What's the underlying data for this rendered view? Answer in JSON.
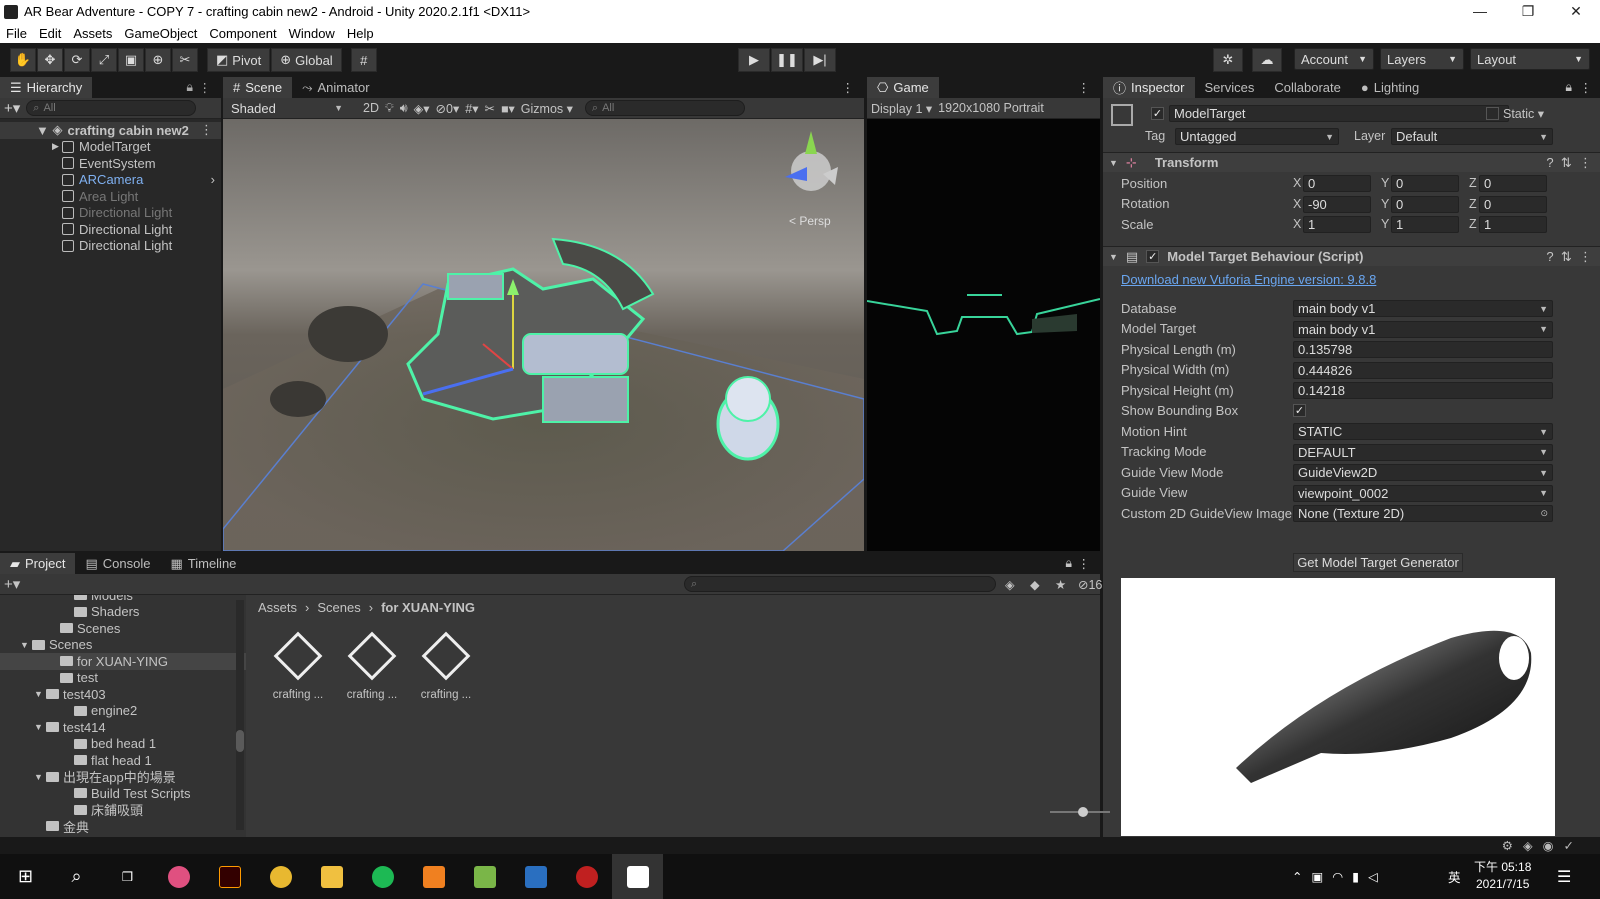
{
  "window": {
    "title": "AR Bear Adventure - COPY 7 - crafting cabin new2 - Android - Unity 2020.2.1f1 <DX11>",
    "min": "—",
    "max": "❐",
    "close": "✕"
  },
  "menu": [
    "File",
    "Edit",
    "Assets",
    "GameObject",
    "Component",
    "Window",
    "Help"
  ],
  "toolbar": {
    "pivot": "Pivot",
    "global": "Global",
    "account": "Account",
    "layers": "Layers",
    "layout": "Layout"
  },
  "hierarchy": {
    "tab": "Hierarchy",
    "search": "All",
    "scene": "crafting cabin new2",
    "items": [
      {
        "label": "ModelTarget",
        "state": "normal",
        "foldout": true
      },
      {
        "label": "EventSystem",
        "state": "normal",
        "foldout": false
      },
      {
        "label": "ARCamera",
        "state": "blue",
        "foldout": false
      },
      {
        "label": "Area Light",
        "state": "dim",
        "foldout": false
      },
      {
        "label": "Directional Light",
        "state": "dim",
        "foldout": false
      },
      {
        "label": "Directional Light",
        "state": "normal",
        "foldout": false
      },
      {
        "label": "Directional Light",
        "state": "normal",
        "foldout": false
      }
    ]
  },
  "scene": {
    "tab": "Scene",
    "tab2": "Animator",
    "shading": "Shaded",
    "mode2d": "2D",
    "hidden_count": "0",
    "gizmos": "Gizmos",
    "search": "All",
    "persp": "< Persp"
  },
  "game": {
    "tab": "Game",
    "display": "Display 1",
    "resolution": "1920x1080 Portrait"
  },
  "inspector": {
    "tabs": [
      "Inspector",
      "Services",
      "Collaborate",
      "Lighting"
    ],
    "object": "ModelTarget",
    "static": "Static",
    "tag_label": "Tag",
    "tag": "Untagged",
    "layer_label": "Layer",
    "layer": "Default",
    "transform": {
      "title": "Transform",
      "rows": [
        {
          "label": "Position",
          "x": "0",
          "y": "0",
          "z": "0"
        },
        {
          "label": "Rotation",
          "x": "-90",
          "y": "0",
          "z": "0"
        },
        {
          "label": "Scale",
          "x": "1",
          "y": "1",
          "z": "1"
        }
      ]
    },
    "script": {
      "title": "Model Target Behaviour (Script)",
      "link": "Download new Vuforia Engine version: 9.8.8",
      "props": [
        {
          "label": "Database",
          "value": "main body v1",
          "dropdown": true
        },
        {
          "label": "Model Target",
          "value": "main body v1",
          "dropdown": true
        },
        {
          "label": "Physical Length (m)",
          "value": "0.135798",
          "dropdown": false
        },
        {
          "label": "Physical Width (m)",
          "value": "0.444826",
          "dropdown": false
        },
        {
          "label": "Physical Height (m)",
          "value": "0.14218",
          "dropdown": false
        },
        {
          "label": "Show Bounding Box",
          "value": "✓",
          "dropdown": false
        },
        {
          "label": "Motion Hint",
          "value": "STATIC",
          "dropdown": true
        },
        {
          "label": "Tracking Mode",
          "value": "DEFAULT",
          "dropdown": true
        },
        {
          "label": "Guide View Mode",
          "value": "GuideView2D",
          "dropdown": true
        },
        {
          "label": "Guide View",
          "value": "viewpoint_0002",
          "dropdown": true
        },
        {
          "label": "Custom 2D GuideView Image",
          "value": "None (Texture 2D)",
          "dropdown": false
        }
      ],
      "button": "Get Model Target Generator"
    }
  },
  "project": {
    "tabs": [
      "Project",
      "Console",
      "Timeline"
    ],
    "count": "16",
    "breadcrumb": [
      "Assets",
      "Scenes",
      "for XUAN-YING"
    ],
    "tree": [
      {
        "label": "Models",
        "indent": 4,
        "fold": ""
      },
      {
        "label": "Shaders",
        "indent": 4,
        "fold": ""
      },
      {
        "label": "Scenes",
        "indent": 3,
        "fold": ""
      },
      {
        "label": "Scenes",
        "indent": 1,
        "fold": "▼"
      },
      {
        "label": "for XUAN-YING",
        "indent": 3,
        "fold": ""
      },
      {
        "label": "test",
        "indent": 3,
        "fold": ""
      },
      {
        "label": "test403",
        "indent": 2,
        "fold": "▼"
      },
      {
        "label": "engine2",
        "indent": 4,
        "fold": ""
      },
      {
        "label": "test414",
        "indent": 2,
        "fold": "▼"
      },
      {
        "label": "bed head 1",
        "indent": 4,
        "fold": ""
      },
      {
        "label": "flat head 1",
        "indent": 4,
        "fold": ""
      },
      {
        "label": "出現在app中的場景",
        "indent": 2,
        "fold": "▼"
      },
      {
        "label": "Build Test Scripts",
        "indent": 4,
        "fold": ""
      },
      {
        "label": "床鋪吸頭",
        "indent": 4,
        "fold": ""
      },
      {
        "label": "金典",
        "indent": 2,
        "fold": ""
      }
    ],
    "assets": [
      "crafting ...",
      "crafting ...",
      "crafting ..."
    ]
  },
  "taskbar": {
    "time": "下午 05:18",
    "date": "2021/7/15",
    "ime": "英"
  }
}
